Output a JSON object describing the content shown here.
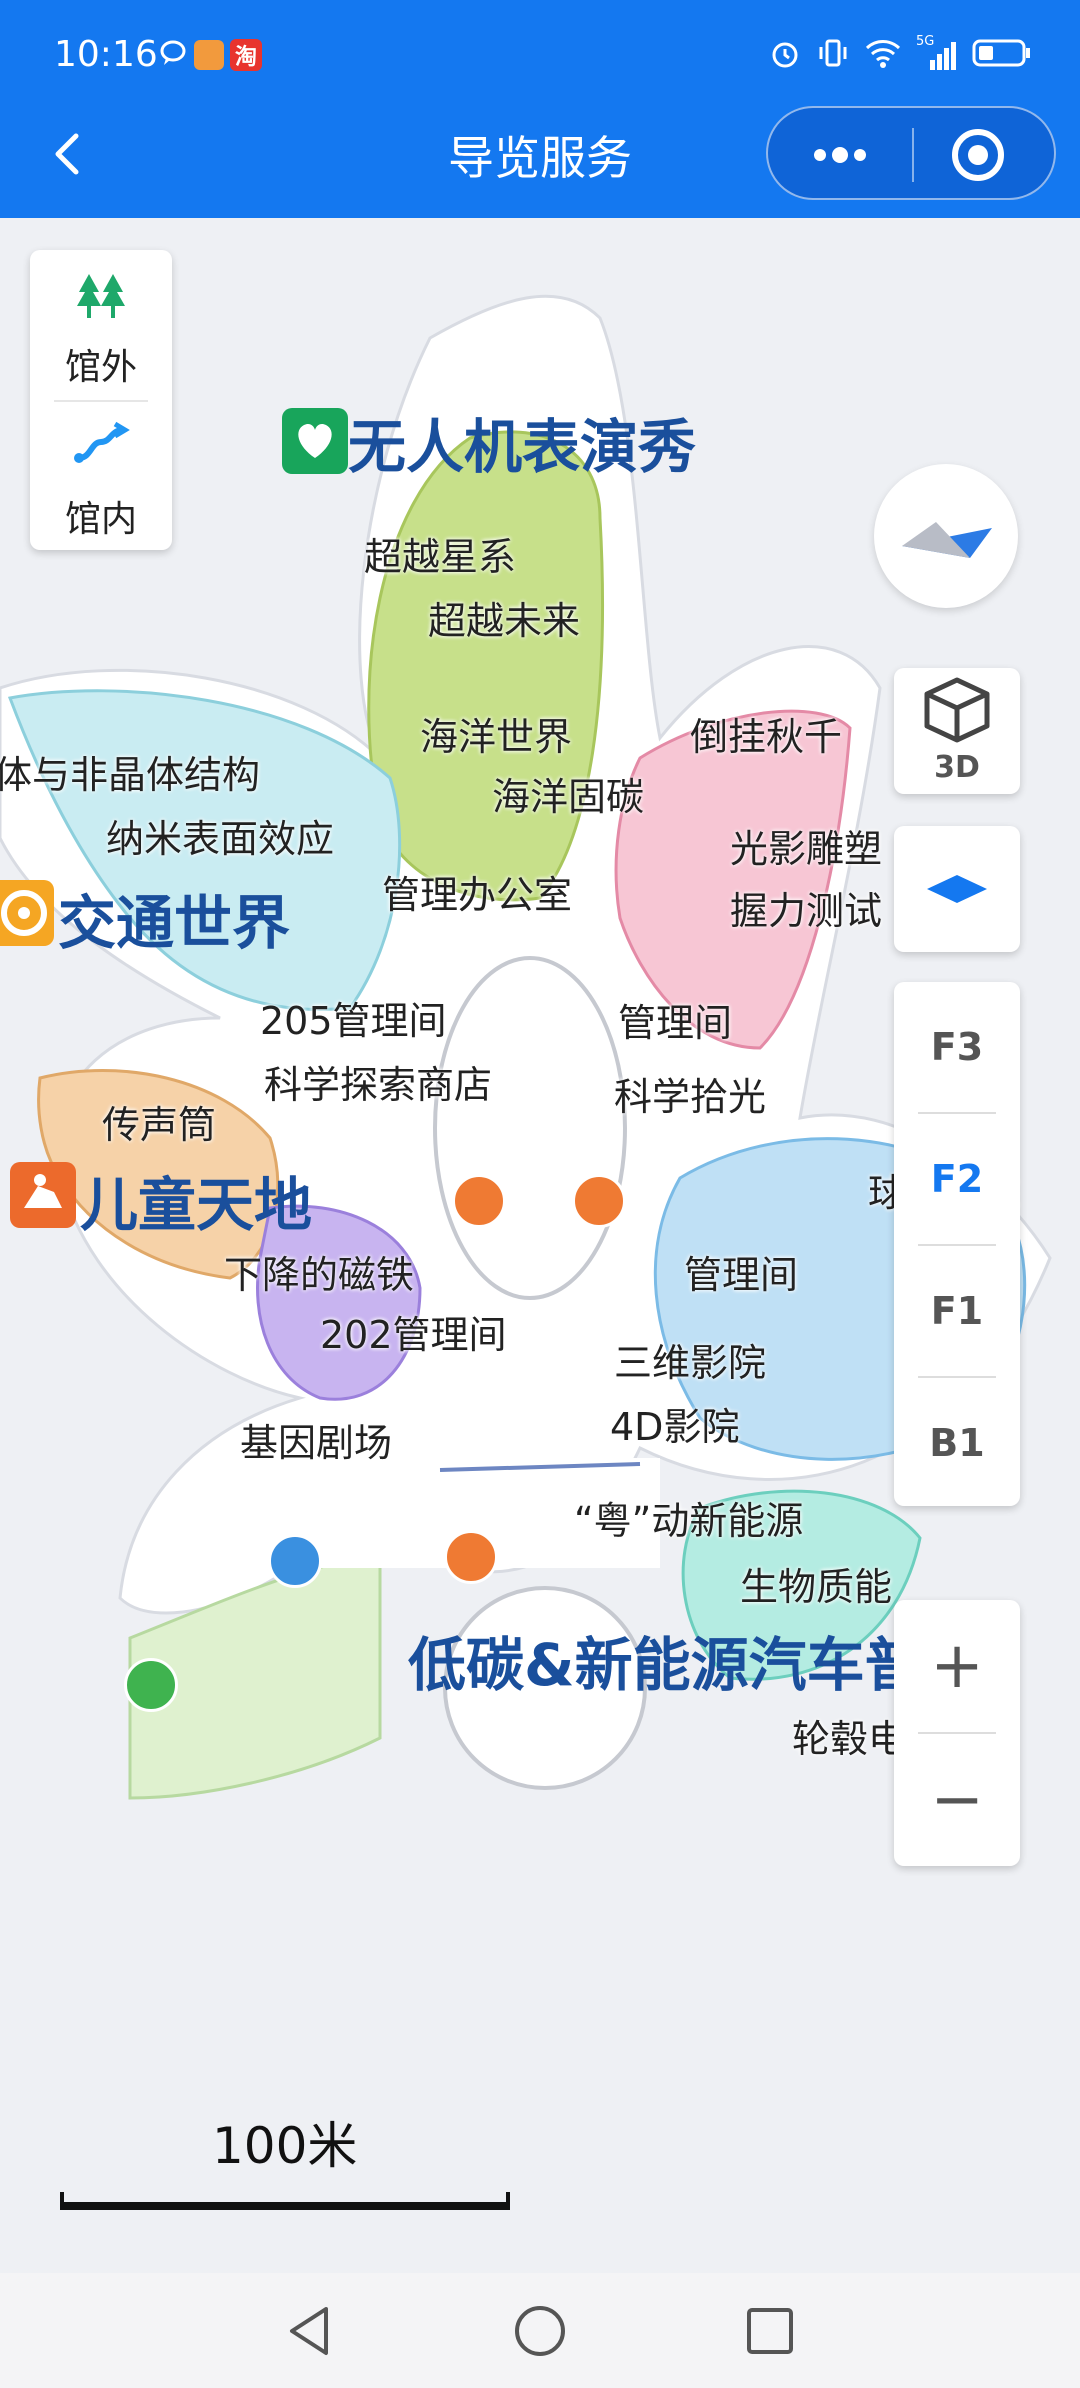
{
  "status_bar": {
    "time": "10:16",
    "app_badge": "淘",
    "network": "5G"
  },
  "nav": {
    "title": "导览服务"
  },
  "map_toggle": {
    "outside_label": "馆外",
    "inside_label": "馆内"
  },
  "view_control": {
    "label_3d": "3D"
  },
  "floors": {
    "items": [
      "F3",
      "F2",
      "F1",
      "B1"
    ],
    "selected": "F2"
  },
  "zoom": {
    "in_label": "+",
    "out_label": "−"
  },
  "scale_bar": {
    "label": "100米"
  },
  "zones": {
    "drone_show": "无人机表演秀",
    "transport": "交通世界",
    "kids": "儿童天地",
    "new_energy": "低碳&新能源汽车普体"
  },
  "labels": {
    "l1": "超越星系",
    "l2": "超越未来",
    "l3": "海洋世界",
    "l4": "倒挂秋千",
    "l5": "体与非晶体结构",
    "l6": "海洋固碳",
    "l7": "纳米表面效应",
    "l8": "光影雕塑",
    "l9": "管理办公室",
    "l10": "握力测试",
    "l11": "205管理间",
    "l12": "管理间",
    "l13": "科学探索商店",
    "l14": "科学拾光",
    "l15": "传声筒",
    "l16": "球幕影院",
    "l17": "下降的磁铁",
    "l18": "管理间",
    "l19": "202管理间",
    "l20": "三维影院",
    "l21": "基因剧场",
    "l22": "4D影院",
    "l23": "“粤”动新能源",
    "l24": "生物质能",
    "l25": "轮毂电机"
  },
  "colors": {
    "header": "#1478f0",
    "active_floor": "#1478f0",
    "zone_title": "#1a4f9c"
  }
}
